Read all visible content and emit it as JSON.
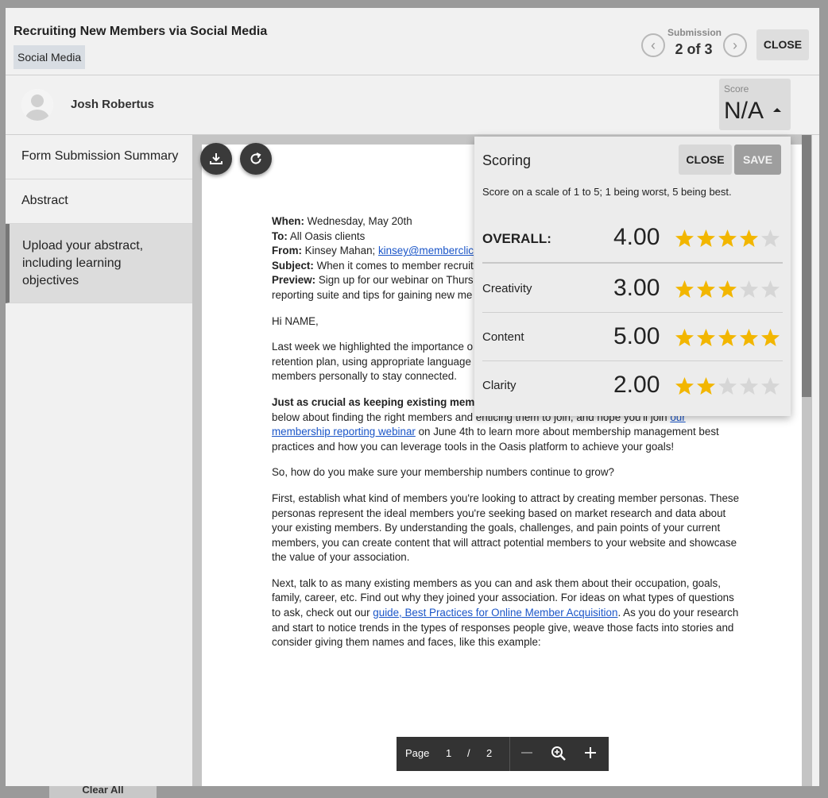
{
  "backdrop": {
    "clear_all": "Clear All"
  },
  "header": {
    "title": "Recruiting New Members via Social Media",
    "tag": "Social Media",
    "submission_label": "Submission",
    "submission_count": "2 of 3",
    "close_label": "CLOSE"
  },
  "user": {
    "name": "Josh Robertus"
  },
  "score": {
    "label": "Score",
    "value": "N/A"
  },
  "sidebar": {
    "items": [
      {
        "label": "Form Submission Summary"
      },
      {
        "label": "Abstract"
      },
      {
        "label": "Upload your abstract, including learning objectives"
      }
    ]
  },
  "document": {
    "when_label": "When:",
    "when_value": "Wednesday, May 20th",
    "to_label": "To:",
    "to_value": "All Oasis clients",
    "from_label": "From:",
    "from_value": "Kinsey Mahan;",
    "from_email": "kinsey@memberclic",
    "subject_label": "Subject:",
    "subject_value": "When it comes to member recruit",
    "preview_label": "Preview:",
    "preview_value": "Sign up for our webinar on Thurs",
    "preview_cont": "reporting suite and tips for gaining new me",
    "greeting": "Hi NAME,",
    "p1": "Last week we highlighted the importance o",
    "p1b": "retention plan, using appropriate language",
    "p1c": "members personally to stay connected.",
    "p2_bold": "Just as crucial as keeping existing mem",
    "p2b": "below about finding the right members and enticing them to join, and hope you'll join",
    "p2_link1": "our",
    "p2_link2": "membership reporting webinar",
    "p2c": "on June 4th to learn more about membership management best",
    "p2d": "practices and how you can leverage tools in the Oasis platform to achieve your goals!",
    "p3": "So, how do you make sure your membership numbers continue to grow?",
    "p4": "First, establish what kind of members you're looking to attract by creating member personas. These personas represent the ideal members you're seeking based on market research and data about your existing members. By understanding the goals, challenges, and pain points of your current members, you can create content that will attract potential members to your website and showcase the value of your association.",
    "p5a": "Next, talk to as many existing members as you can and ask them about their occupation, goals, family, career, etc. Find out why they joined your association. For ideas on what types of questions to ask, check out our",
    "p5_link": "guide, Best Practices for Online Member Acquisition",
    "p5b": ". As you do your research and start to notice trends in the types of responses people give, weave those facts into stories and consider giving them names and faces, like this example:"
  },
  "pager": {
    "page_label": "Page",
    "current": "1",
    "slash": "/",
    "total": "2"
  },
  "scoring": {
    "title": "Scoring",
    "close_label": "CLOSE",
    "save_label": "SAVE",
    "description": "Score on a scale of 1 to 5; 1 being worst, 5 being best.",
    "overall": {
      "label": "OVERALL:",
      "value": "4.00",
      "stars": 4
    },
    "criteria": [
      {
        "label": "Creativity",
        "value": "3.00",
        "stars": 3
      },
      {
        "label": "Content",
        "value": "5.00",
        "stars": 5
      },
      {
        "label": "Clarity",
        "value": "2.00",
        "stars": 2
      }
    ],
    "colors": {
      "star_on": "#f2b600",
      "star_off": "#d6d6d6"
    }
  }
}
